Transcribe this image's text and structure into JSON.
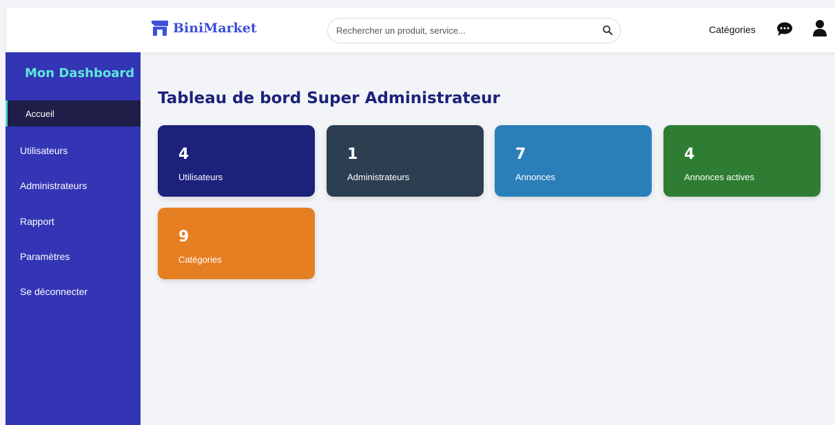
{
  "header": {
    "brand": "BiniMarket",
    "search": {
      "placeholder": "Rechercher un produit, service...",
      "value": ""
    },
    "categories_link": "Catégories",
    "icons": [
      "shop-icon",
      "search-icon",
      "chat-icon",
      "user-icon"
    ]
  },
  "sidebar": {
    "title": "Mon Dashboard",
    "items": [
      {
        "label": "Accueil",
        "active": true
      },
      {
        "label": "Utilisateurs"
      },
      {
        "label": "Administrateurs"
      },
      {
        "label": "Rapport"
      },
      {
        "label": "Paramètres"
      },
      {
        "label": "Se déconnecter"
      }
    ]
  },
  "main": {
    "title": "Tableau de bord Super Administrateur",
    "cards": [
      {
        "value": "4",
        "label": "Utilisateurs",
        "color": "#1c217c"
      },
      {
        "value": "1",
        "label": "Administrateurs",
        "color": "#2c3e50"
      },
      {
        "value": "7",
        "label": "Annonces",
        "color": "#2a7fb9"
      },
      {
        "value": "4",
        "label": "Annonces actives",
        "color": "#2e7d32"
      },
      {
        "value": "9",
        "label": "Catégories",
        "color": "#e67e22"
      }
    ]
  },
  "colors": {
    "brand": "#3d4fd6",
    "sidebar_bg": "#3335b5",
    "sidebar_title": "#5ee7d8",
    "active_item_bg": "#1e1e48",
    "page_title": "#1c237a",
    "page_bg": "#f3f4f8"
  }
}
